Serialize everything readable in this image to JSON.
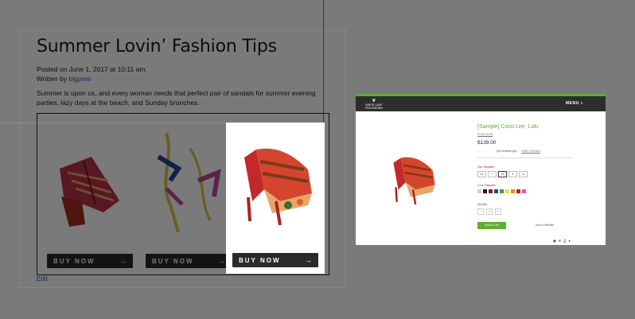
{
  "blog": {
    "title": "Summer Lovin’ Fashion Tips",
    "posted_on": "Posted on June 1, 2017 at 10:11 am.",
    "written_by_prefix": "Written by",
    "author": "bigpres",
    "excerpt": "Summer is upon us, and every woman needs that perfect pair of sandals for summer evening parties, lazy days at the beach, and Sunday brunches.",
    "buy_now": "BUY NOW",
    "arrow": "→",
    "edit": "Edit"
  },
  "product": {
    "menu": "MENU ≡",
    "logo_line1": "WHITE LEAF",
    "logo_line2": "PROVISIONS",
    "name": "[Sample] Coco Lee, Lulu",
    "brand": "Coco Lee",
    "price": "$139.00",
    "stars": "☆☆☆☆☆",
    "no_reviews": "(No reviews yet)",
    "write_review": "Write a Review",
    "size_label": "Size:",
    "size_required": "Required",
    "sizes": [
      "6S",
      "7",
      "6S",
      "8",
      "7S"
    ],
    "color_label": "Color:",
    "color_required": "Required",
    "colors": [
      "#cfcfcf",
      "#1c1c1c",
      "#8b1b2b",
      "#2a3f9b",
      "#3aa33a",
      "#f0e23c",
      "#f08a1c",
      "#c01d1d",
      "#e05aa6"
    ],
    "qty_label": "Quantity:",
    "qty_minus": "−",
    "qty_value": "1",
    "qty_plus": "+",
    "add_to_cart": "Add to Cart",
    "add_to_wishlist": "Add to Wishlist",
    "share_icons": [
      "facebook-icon",
      "email-icon",
      "print-icon",
      "pinterest-icon"
    ]
  }
}
